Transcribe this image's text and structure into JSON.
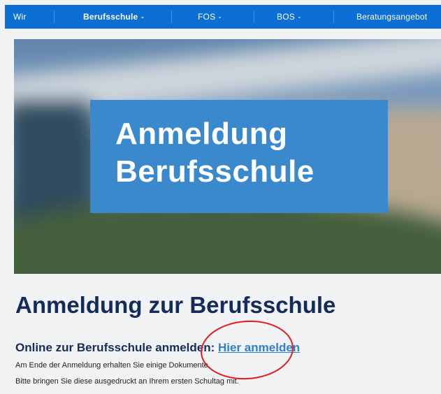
{
  "nav": {
    "items": [
      {
        "label": "Wir",
        "has_menu": false
      },
      {
        "label": "Berufsschule",
        "has_menu": true,
        "active": true
      },
      {
        "label": "FOS",
        "has_menu": true
      },
      {
        "label": "BOS",
        "has_menu": true
      },
      {
        "label": "Beratungsangebot",
        "has_menu": false
      }
    ],
    "chevron": "⌄",
    "background_color": "#0b6fd6"
  },
  "hero": {
    "line1": "Anmeldung",
    "line2": "Berufsschule",
    "box_color": "#3a89cc"
  },
  "main": {
    "title": "Anmeldung zur Berufsschule",
    "subtitle_prefix": "Online zur Berufsschule anmelden:",
    "register_link": "Hier anmelden",
    "info_line1": "Am Ende der Anmeldung erhalten Sie einige Dokumente.",
    "info_line2": "Bitte bringen Sie diese ausgedruckt an Ihrem ersten Schultag mit."
  },
  "annotation": {
    "color": "#e41b1b"
  }
}
